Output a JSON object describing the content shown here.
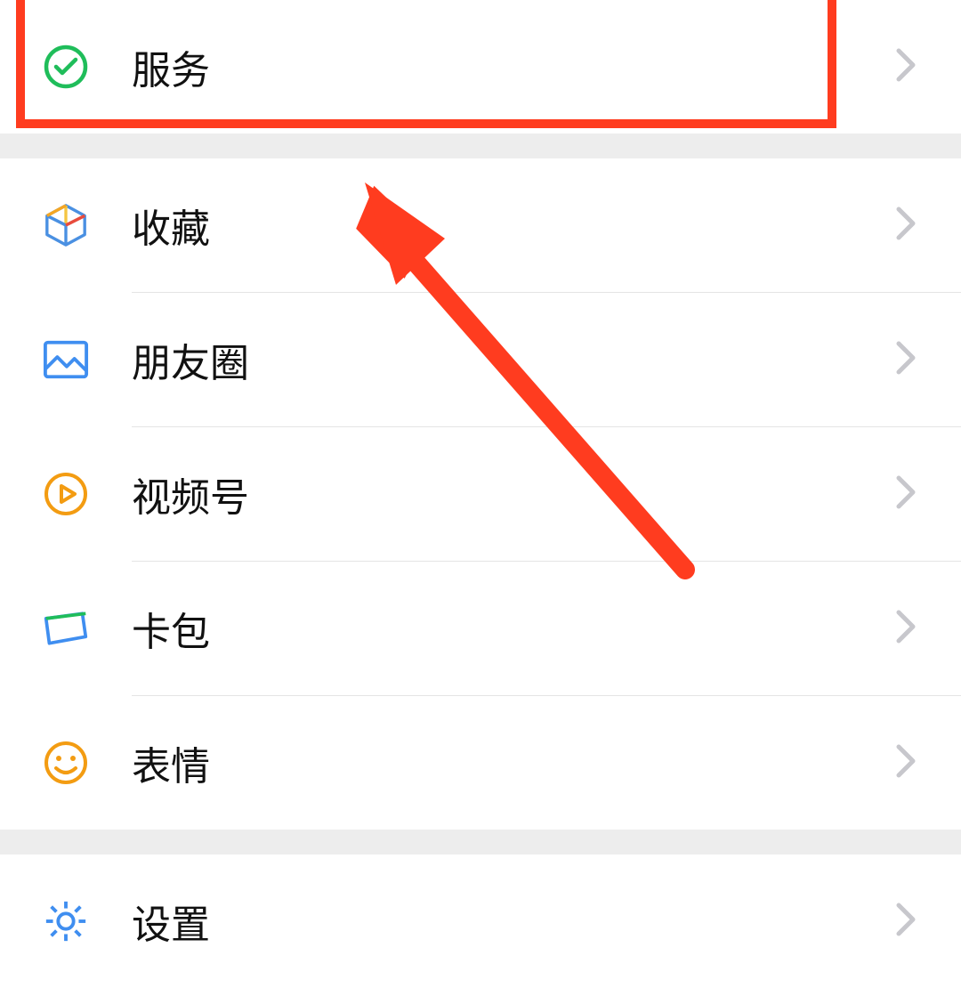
{
  "menu": {
    "services": {
      "label": "服务",
      "icon": "wechat-pay-icon"
    },
    "favorites": {
      "label": "收藏",
      "icon": "cube-icon"
    },
    "moments": {
      "label": "朋友圈",
      "icon": "image-icon"
    },
    "channels": {
      "label": "视频号",
      "icon": "play-icon"
    },
    "cards": {
      "label": "卡包",
      "icon": "card-icon"
    },
    "stickers": {
      "label": "表情",
      "icon": "smile-icon"
    },
    "settings": {
      "label": "设置",
      "icon": "gear-icon"
    }
  },
  "annotation": {
    "highlight_target": "services",
    "arrow_color": "#ff3c1f"
  }
}
